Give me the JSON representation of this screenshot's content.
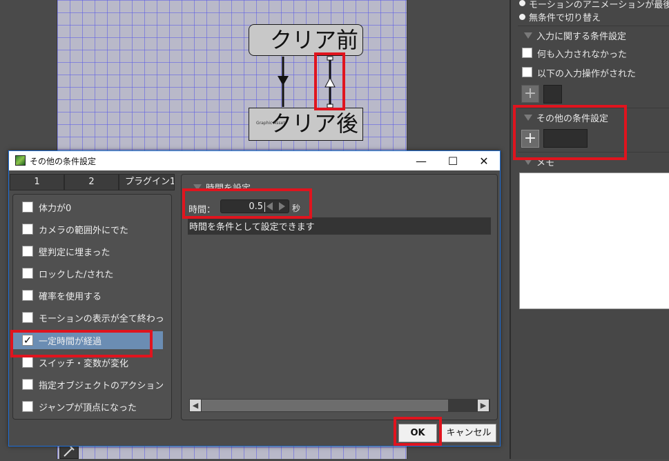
{
  "canvas": {
    "node_before": "クリア前",
    "node_after": "クリア後",
    "node_after_tiny": "Graphic Asset"
  },
  "right_panel": {
    "top_line_1": "モーションのアニメーションが最後",
    "top_line_2": "無条件で切り替え",
    "input_section": "入力に関する条件設定",
    "check_no_input": "何も入力されなかった",
    "check_input_ops": "以下の入力操作がされた",
    "other_section": "その他の条件設定",
    "memo_section": "メモ",
    "plus_icon": "plus-icon"
  },
  "dialog": {
    "title": "その他の条件設定",
    "tabs": [
      "1",
      "2",
      "プラグイン1"
    ],
    "conditions": [
      {
        "label": "体力が0",
        "checked": false
      },
      {
        "label": "カメラの範囲外にでた",
        "checked": false
      },
      {
        "label": "壁判定に埋まった",
        "checked": false
      },
      {
        "label": "ロックした/された",
        "checked": false
      },
      {
        "label": "確率を使用する",
        "checked": false
      },
      {
        "label": "モーションの表示が全て終わった",
        "checked": false
      },
      {
        "label": "一定時間が経過",
        "checked": true
      },
      {
        "label": "スイッチ・変数が変化",
        "checked": false
      },
      {
        "label": "指定オブジェクトのアクションが",
        "checked": false
      },
      {
        "label": "ジャンプが頂点になった",
        "checked": false
      }
    ],
    "section_title": "時間を設定",
    "time_label": "時間：",
    "time_value": "0.5",
    "time_unit": "秒",
    "description": "時間を条件として設定できます",
    "ok": "OK",
    "cancel": "キャンセル",
    "check_mark": "✓",
    "window_min": "—",
    "window_max": "☐",
    "window_close": "✕",
    "scroll_left": "◀",
    "scroll_right": "▶"
  },
  "colors": {
    "highlight_red": "#e0141e",
    "selection_blue": "#6b8db3",
    "dialog_border": "#1e6fd9"
  }
}
